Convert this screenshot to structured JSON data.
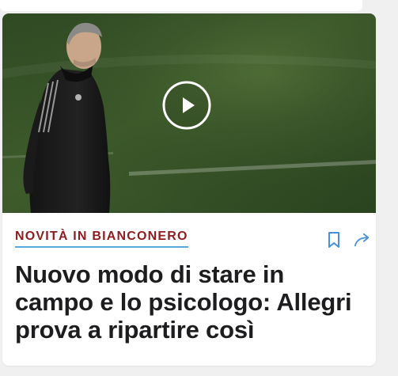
{
  "article": {
    "category": "NOVITÀ IN BIANCONERO",
    "title": "Nuovo modo di stare in campo e lo psicologo: Allegri prova a ripartire così"
  },
  "colors": {
    "category_text": "#8f1b1f",
    "category_underline": "#59a7e0",
    "action_icons": "#4a90d9",
    "title_text": "#1d1d1f"
  },
  "icons": {
    "play": "play-icon",
    "bookmark": "bookmark-icon",
    "share": "share-arrow-icon"
  }
}
